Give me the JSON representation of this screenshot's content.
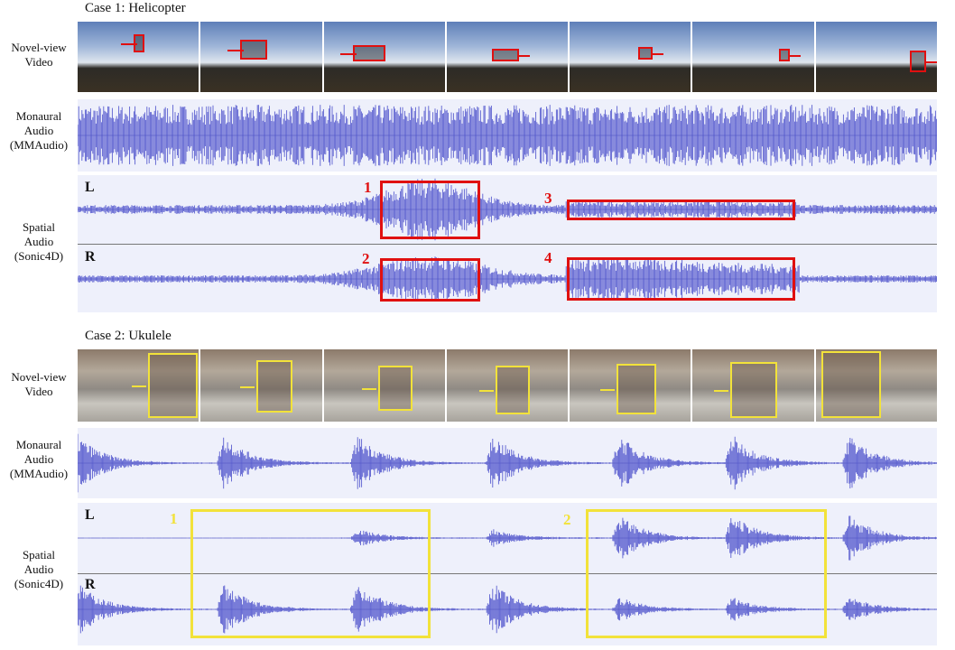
{
  "case1": {
    "title": "Case 1: Helicopter",
    "labels": {
      "video": [
        "Novel-view",
        "Video"
      ],
      "mono": [
        "Monaural",
        "Audio",
        "(MMAudio)"
      ],
      "spatial": [
        "Spatial",
        "Audio",
        "(Sonic4D)"
      ]
    },
    "channels": {
      "left": "L",
      "right": "R"
    },
    "annotations": [
      "1",
      "2",
      "3",
      "4"
    ],
    "frame_count": 7
  },
  "case2": {
    "title": "Case 2: Ukulele",
    "labels": {
      "video": [
        "Novel-view",
        "Video"
      ],
      "mono": [
        "Monaural",
        "Audio",
        "(MMAudio)"
      ],
      "spatial": [
        "Spatial",
        "Audio",
        "(Sonic4D)"
      ]
    },
    "channels": {
      "left": "L",
      "right": "R"
    },
    "annotations": [
      "1",
      "2"
    ],
    "frame_count": 7
  },
  "colors": {
    "waveform": "#5b5fd0",
    "wave_bg": "#eef0fb",
    "case1_box": "#e01010",
    "case2_box": "#f2e23a"
  }
}
